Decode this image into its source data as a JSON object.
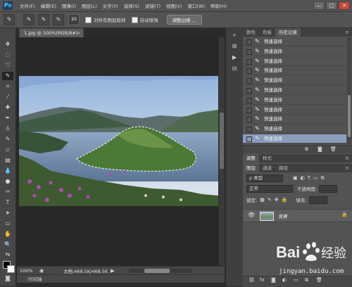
{
  "app": {
    "logo": "Ps"
  },
  "menu": [
    "文件(F)",
    "编辑(E)",
    "图像(I)",
    "图层(L)",
    "文字(Y)",
    "选择(S)",
    "滤镜(T)",
    "视图(V)",
    "窗口(W)",
    "帮助(H)"
  ],
  "window_controls": [
    "—",
    "□",
    "✕"
  ],
  "options": {
    "brush_size": "20",
    "sample_all_label": "对所有图层取样",
    "auto_enhance_label": "自动增强",
    "refine_edge_label": "调整边缘 ..."
  },
  "document": {
    "tab_title": "1.jpg @ 100%(RGB/8#)",
    "close": "×",
    "zoom": "100%",
    "doc_size": "文档:468.5K/468.5K"
  },
  "timeline_label": "时间轴",
  "history_panel": {
    "tabs": [
      "颜色",
      "色板",
      "历史记录"
    ],
    "active_tab": 2,
    "items": [
      "快速选择",
      "快速选择",
      "快速选择",
      "快速选择",
      "快速选择",
      "快速选择",
      "快速选择",
      "快速选择",
      "快速选择",
      "快速选择",
      "快速选择"
    ],
    "selected_index": 10
  },
  "adjust_panel": {
    "tabs": [
      "调整",
      "样式"
    ],
    "active_tab": 0
  },
  "layers_panel": {
    "tabs": [
      "图层",
      "通道",
      "路径"
    ],
    "filter_label": "ρ 类型",
    "blend_mode": "正常",
    "opacity_label": "不透明度:",
    "lock_label": "锁定:",
    "fill_label": "填充:",
    "layer_name": "背景"
  },
  "watermark": {
    "brand": "Bai",
    "brand2": "经验",
    "url": "jingyan.baidu.com"
  },
  "colors": {
    "accent": "#5ac4ff",
    "selection": "#8a9cbc"
  }
}
